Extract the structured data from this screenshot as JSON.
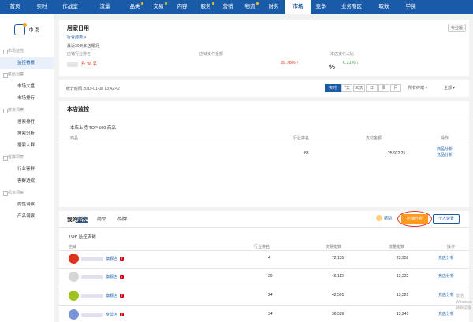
{
  "nav": [
    "首页",
    "实时",
    "作战室",
    "流量",
    "品类",
    "交易",
    "内容",
    "服务",
    "营销",
    "物流",
    "财务",
    "市场",
    "竞争",
    "业务专区",
    "取数",
    "学院"
  ],
  "nav_dots": [
    4,
    5,
    7,
    9
  ],
  "nav_active": 11,
  "sidebar": {
    "title": "市场",
    "groups": [
      {
        "label": "市场监控",
        "items": [
          "监控看板"
        ]
      },
      {
        "label": "供给洞察",
        "items": [
          "市场大盘",
          "市场排行"
        ]
      },
      {
        "label": "搜索洞察",
        "items": [
          "搜索排行",
          "搜索分析",
          "搜索人群"
        ]
      },
      {
        "label": "客群洞察",
        "items": [
          "行业客群",
          "客群透视"
        ]
      },
      {
        "label": "机会洞察",
        "items": [
          "属性洞察",
          "产品洞察"
        ]
      }
    ],
    "active_item": "监控看板"
  },
  "summary": {
    "title": "居家日用",
    "tag": "专业版",
    "link": "行业趋势 >",
    "sub": "最近30天本店概况",
    "m1_label": "店铺行业排名",
    "m1_value": "升 36 名",
    "m2_label": "店铺支付金额",
    "m2_value": "39.78%",
    "m3_label": "本店支付占比",
    "m3_value": "0.21%"
  },
  "filter": {
    "time": "统计时间 2019-01-08 13:42:42",
    "ranges": [
      "实时",
      "7天",
      "30天",
      "日",
      "周",
      "月"
    ],
    "device": "所有终端",
    "scope": "全部"
  },
  "store_monitor": {
    "title": "本店监控",
    "caption": "本店上榜 TOP 500 商品",
    "headers": [
      "商品",
      "行业排名",
      "支付金额",
      "操作"
    ],
    "row": {
      "rank": "88",
      "amount": "25,922.25",
      "op1": "商品分析",
      "op2": "竞品分析"
    }
  },
  "my_monitor": {
    "title": "我的监控",
    "tabs": [
      "店铺",
      "商品",
      "品牌"
    ],
    "help": "帮助",
    "btn_primary": "店铺分析",
    "btn_secondary": "个人设置",
    "caption": "TOP 监控店铺",
    "headers": [
      "店铺",
      "行业排名",
      "交易指数",
      "流量指数",
      "操作"
    ],
    "rows": [
      {
        "name": "旗舰店",
        "rank": "4",
        "trade": "72,135",
        "traffic": "23,952",
        "op": "竞店分析",
        "avatar": "#e0321d"
      },
      {
        "name": "旗舰店",
        "rank": "20",
        "trade": "46,112",
        "traffic": "13,222",
        "op": "竞店分析",
        "avatar": "#d6d6d6"
      },
      {
        "name": "旗舰店",
        "rank": "24",
        "trade": "42,591",
        "traffic": "13,321",
        "op": "竞店分析",
        "avatar": "#9dc31c"
      },
      {
        "name": "专营店",
        "rank": "34",
        "trade": "36,526",
        "traffic": "13,245",
        "op": "竞店分析",
        "avatar": "#7a96d8"
      }
    ]
  },
  "watermark": "激活 Windows 转到设置"
}
